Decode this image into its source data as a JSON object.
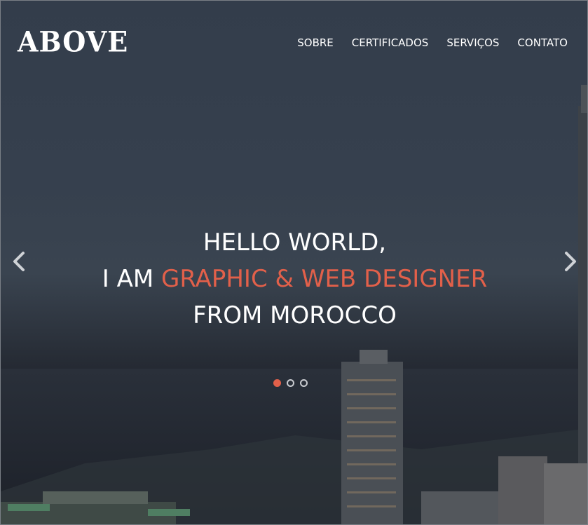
{
  "brand": {
    "logo_text": "ABOVE"
  },
  "nav": {
    "items": [
      {
        "label": "SOBRE"
      },
      {
        "label": "CERTIFICADOS"
      },
      {
        "label": "SERVIÇOS"
      },
      {
        "label": "CONTATO"
      }
    ]
  },
  "hero": {
    "line1": "HELLO WORLD,",
    "line2_prefix": "I AM ",
    "line2_accent": "GRAPHIC & WEB DESIGNER",
    "line3": "FROM MOROCCO"
  },
  "slider": {
    "slide_count": 3,
    "active_index": 0,
    "prev_icon": "chevron-left-icon",
    "next_icon": "chevron-right-icon"
  },
  "colors": {
    "accent": "#e2604a",
    "text": "#ffffff"
  }
}
